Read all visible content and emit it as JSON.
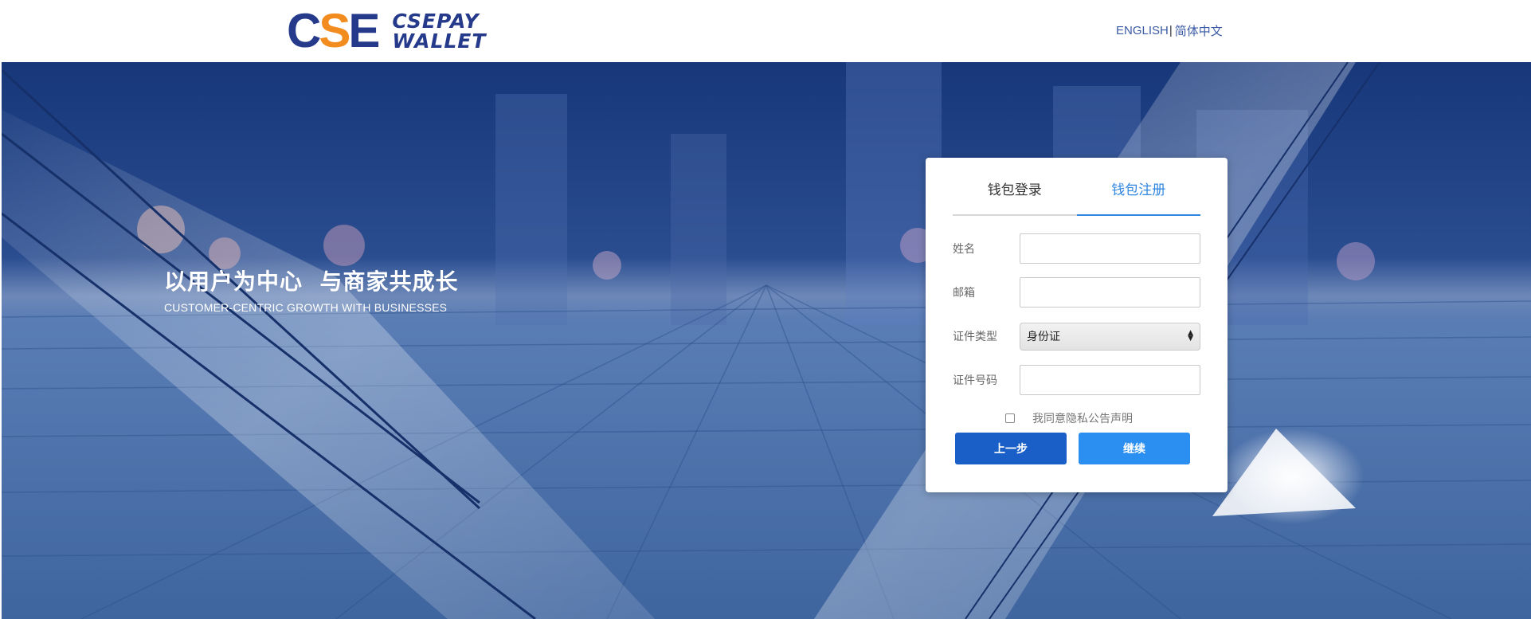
{
  "header": {
    "logo_mark": [
      "C",
      "S",
      "E"
    ],
    "logo_line1": "CSEPAY",
    "logo_line2": "WALLET",
    "lang_english": "ENGLISH",
    "lang_separator": "|",
    "lang_chinese": "简体中文"
  },
  "hero": {
    "slogan_cn": "以用户为中心  与商家共成长",
    "slogan_en": "CUSTOMER-CENTRIC GROWTH WITH BUSINESSES"
  },
  "form": {
    "tabs": [
      {
        "label": "钱包登录",
        "active": false
      },
      {
        "label": "钱包注册",
        "active": true
      }
    ],
    "fields": {
      "name_label": "姓名",
      "name_value": "",
      "email_label": "邮箱",
      "email_value": "",
      "id_type_label": "证件类型",
      "id_type_selected": "身份证",
      "id_number_label": "证件号码",
      "id_number_value": ""
    },
    "agree_label": "我同意隐私公告声明",
    "agree_checked": false,
    "prev_button": "上一步",
    "continue_button": "继续"
  },
  "colors": {
    "brand_blue": "#263a8c",
    "brand_orange": "#f28c1e",
    "tab_active": "#2f86e0",
    "btn_prev": "#1a5fc7",
    "btn_next": "#2a8ff0"
  }
}
